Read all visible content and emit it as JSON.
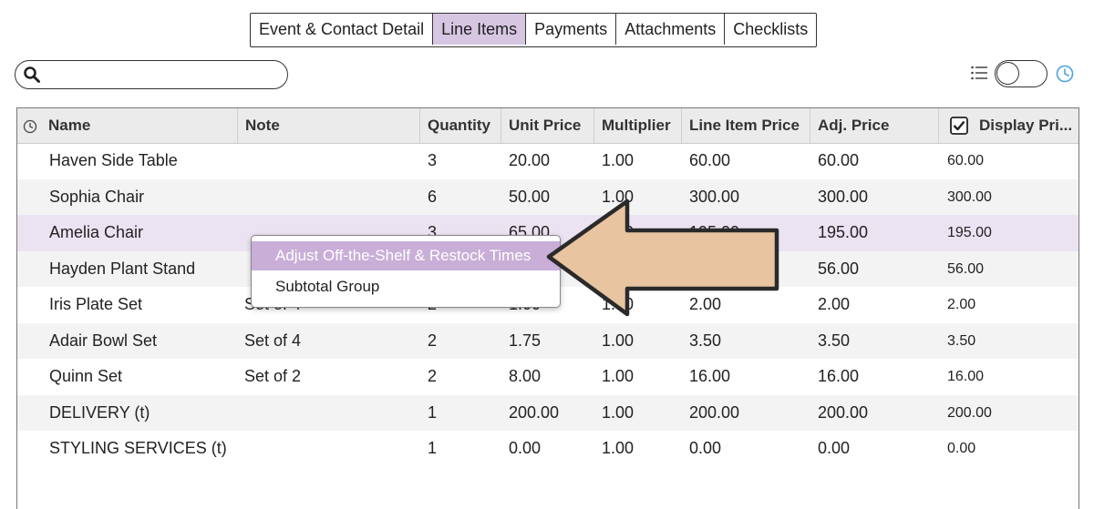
{
  "tabs": [
    {
      "label": "Event & Contact Detail",
      "active": false
    },
    {
      "label": "Line Items",
      "active": true
    },
    {
      "label": "Payments",
      "active": false
    },
    {
      "label": "Attachments",
      "active": false
    },
    {
      "label": "Checklists",
      "active": false
    }
  ],
  "search": {
    "value": "",
    "placeholder": ""
  },
  "table": {
    "columns": [
      "Name",
      "Note",
      "Quantity",
      "Unit Price",
      "Multiplier",
      "Line Item Price",
      "Adj. Price",
      "Display Pri..."
    ],
    "display_price_checked": true,
    "rows": [
      {
        "name": "Haven Side Table",
        "note": "",
        "quantity": "3",
        "unit_price": "20.00",
        "multiplier": "1.00",
        "line_item_price": "60.00",
        "adj_price": "60.00",
        "display_price": "60.00"
      },
      {
        "name": "Sophia Chair",
        "note": "",
        "quantity": "6",
        "unit_price": "50.00",
        "multiplier": "1.00",
        "line_item_price": "300.00",
        "adj_price": "300.00",
        "display_price": "300.00"
      },
      {
        "name": "Amelia Chair",
        "note": "",
        "quantity": "3",
        "unit_price": "65.00",
        "multiplier": "1.00",
        "line_item_price": "195.00",
        "adj_price": "195.00",
        "display_price": "195.00"
      },
      {
        "name": "Hayden Plant Stand",
        "note": "",
        "quantity": "",
        "unit_price": "",
        "multiplier": "",
        "line_item_price": "",
        "adj_price": "56.00",
        "display_price": "56.00"
      },
      {
        "name": "Iris Plate Set",
        "note": "Set of 4",
        "quantity": "2",
        "unit_price": "1.00",
        "multiplier": "1.00",
        "line_item_price": "2.00",
        "adj_price": "2.00",
        "display_price": "2.00"
      },
      {
        "name": "Adair Bowl Set",
        "note": "Set of 4",
        "quantity": "2",
        "unit_price": "1.75",
        "multiplier": "1.00",
        "line_item_price": "3.50",
        "adj_price": "3.50",
        "display_price": "3.50"
      },
      {
        "name": "Quinn Set",
        "note": "Set of 2",
        "quantity": "2",
        "unit_price": "8.00",
        "multiplier": "1.00",
        "line_item_price": "16.00",
        "adj_price": "16.00",
        "display_price": "16.00"
      },
      {
        "name": "DELIVERY (t)",
        "note": "",
        "quantity": "1",
        "unit_price": "200.00",
        "multiplier": "1.00",
        "line_item_price": "200.00",
        "adj_price": "200.00",
        "display_price": "200.00"
      },
      {
        "name": "STYLING SERVICES (t)",
        "note": "",
        "quantity": "1",
        "unit_price": "0.00",
        "multiplier": "1.00",
        "line_item_price": "0.00",
        "adj_price": "0.00",
        "display_price": "0.00"
      }
    ]
  },
  "context_menu": {
    "items": [
      "Adjust Off-the-Shelf & Restock Times",
      "Subtotal Group"
    ],
    "highlighted_index": 0
  },
  "colors": {
    "active_tab": "#d7c6e2",
    "selected_row": "#ece3f2",
    "menu_highlight": "#c9aed8",
    "arrow_fill": "#e8c4a0",
    "accent_blue": "#4aa3df"
  },
  "icons": [
    "search-icon",
    "list-icon",
    "clock-icon",
    "checkbox-icon"
  ]
}
